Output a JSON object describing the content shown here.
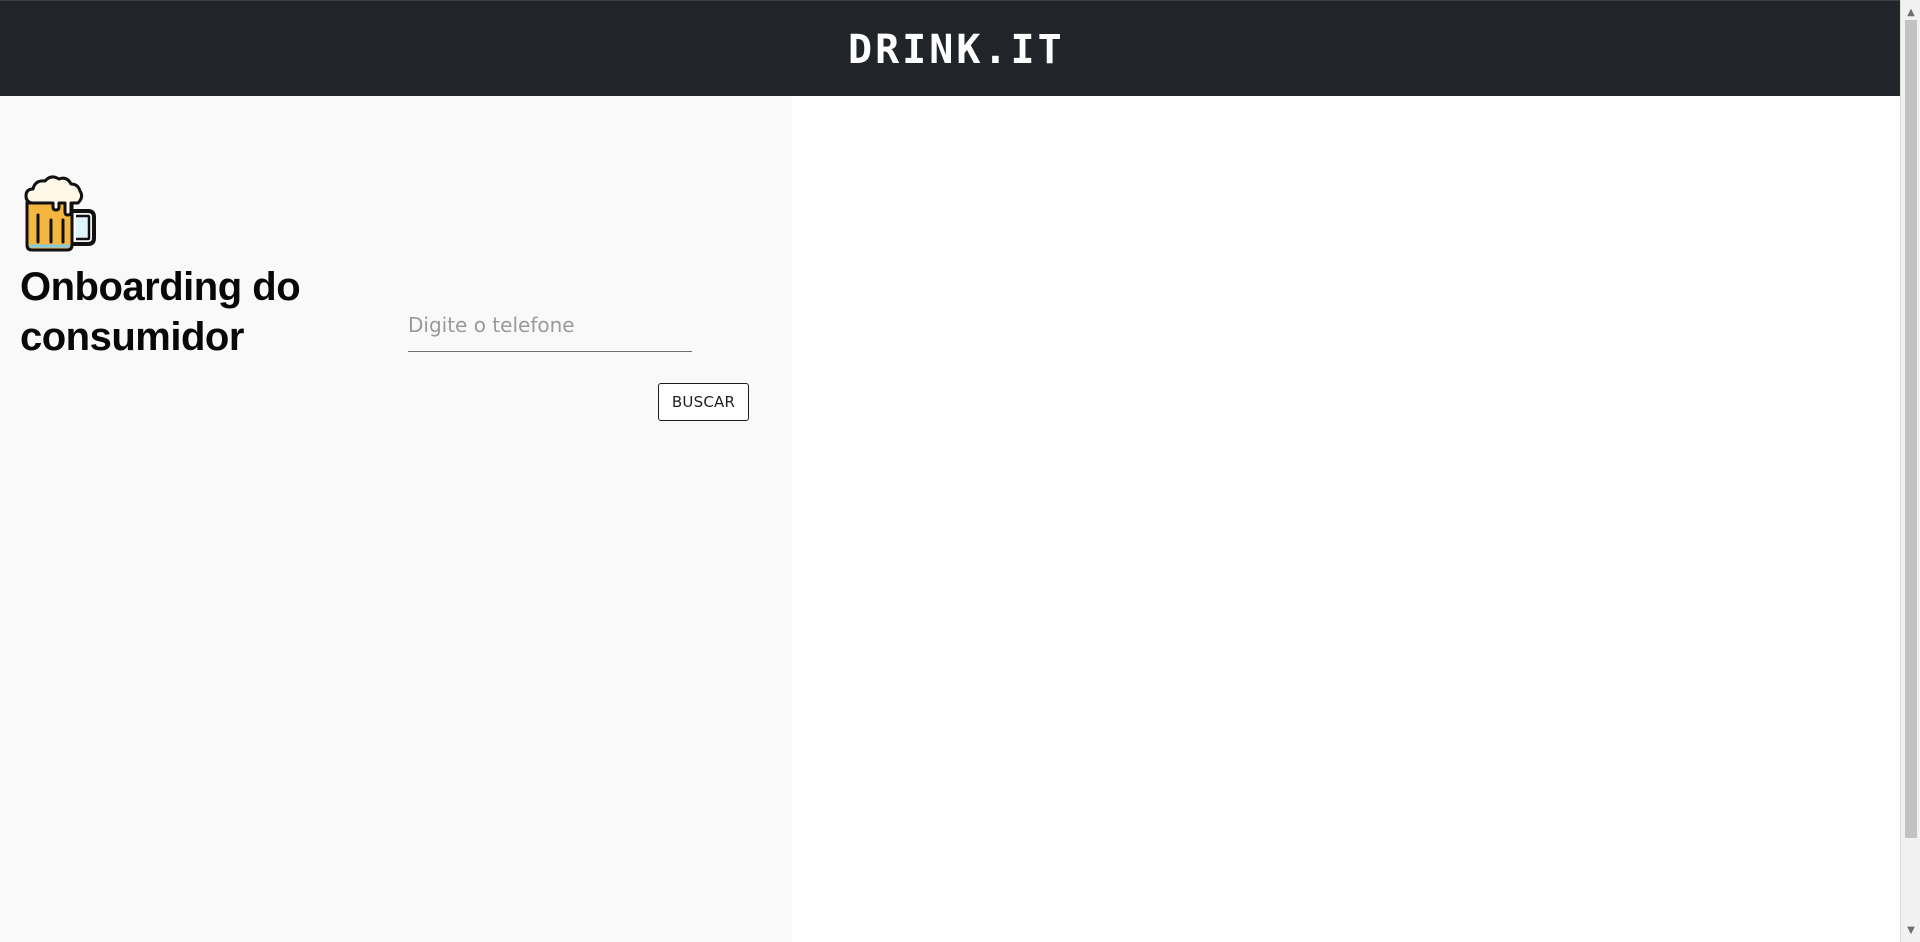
{
  "header": {
    "logo": "DRINK.IT",
    "background_color": "#222529"
  },
  "left_panel": {
    "icon": "beer-mug-icon",
    "title": "Onboarding do consumidor"
  },
  "form": {
    "phone_placeholder": "Digite o telefone",
    "phone_value": "",
    "search_button_label": "BUSCAR"
  },
  "scrollbar": {
    "up_icon": "scroll-up-icon",
    "down_icon": "scroll-down-icon"
  }
}
